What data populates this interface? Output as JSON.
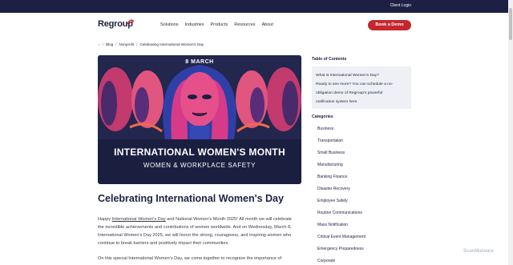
{
  "topbar": {
    "client_login": "Client Login"
  },
  "header": {
    "logo": "Regroup",
    "nav": [
      "Solutions",
      "Industries",
      "Products",
      "Resources",
      "About"
    ],
    "cta": "Book a Demo"
  },
  "breadcrumb": {
    "items": [
      "Blog",
      "Nonprofit",
      "Celebrating International Women's Day"
    ]
  },
  "hero": {
    "date": "8 MARCH",
    "title": "INTERNATIONAL WOMEN'S MONTH",
    "subtitle": "WOMEN & WORKPLACE SAFETY"
  },
  "article": {
    "title": "Celebrating International Women's Day",
    "p1_a": "Happy ",
    "p1_link": "International Women's Day",
    "p1_b": " and National Women's Month 2025! All month we will celebrate the incredible achievements and contributions of women worldwide. And on Wednesday, March 8, International Women's Day 2025, we will honor the strong, courageous, and inspiring women who continue to break barriers and positively impact their communities.",
    "p2": "On this special International Women's Day, we come together to recognize the importance of"
  },
  "toc": {
    "heading": "Table of Contents",
    "items": [
      "What is International Women's Day?",
      "Ready to see more? You can schedule a no-",
      "obligation demo of Regroup's powerful",
      "notification system here."
    ]
  },
  "categories": {
    "heading": "Categories",
    "items": [
      "Business",
      "Transportation",
      "Small Business",
      "Manufacturing",
      "Banking Finance",
      "Disaster Recovery",
      "Employee Safety",
      "Routine Communications",
      "Mass Notification",
      "Critical Event Management",
      "Emergency Preparedness",
      "Corporate"
    ]
  },
  "watermark": "ScanMalware",
  "colors": {
    "navy": "#1e2043",
    "accent": "#c5272f",
    "panel": "#eef0f5"
  }
}
